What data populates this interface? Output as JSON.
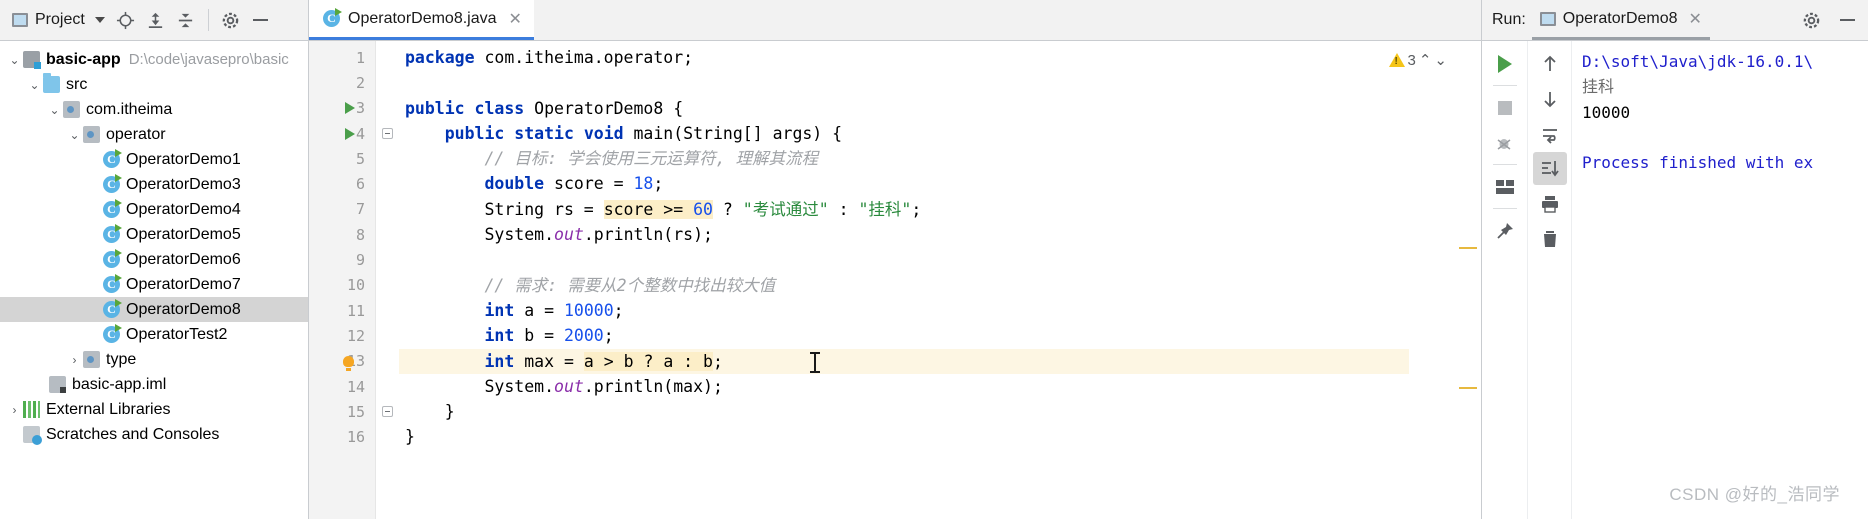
{
  "sidebar": {
    "header": {
      "panel_label": "Project",
      "icons": [
        {
          "name": "project-panel-icon",
          "glyph": "▣"
        },
        {
          "name": "chevron-down-icon",
          "glyph": "▾"
        },
        {
          "name": "locate-target-icon",
          "glyph": "⌖"
        },
        {
          "name": "expand-all-icon",
          "glyph": "⤒"
        },
        {
          "name": "collapse-all-icon",
          "glyph": "⤓"
        },
        {
          "name": "settings-gear-icon",
          "glyph": "⚙"
        },
        {
          "name": "hide-panel-icon",
          "glyph": "—"
        }
      ]
    },
    "tree": [
      {
        "label": "basic-app",
        "path": "D:\\code\\javasepro\\basic",
        "icon": "module-folder-icon",
        "depth": 0,
        "arrow": "expanded",
        "bold": true,
        "selected": false
      },
      {
        "label": "src",
        "path": "",
        "icon": "source-folder-icon",
        "depth": 1,
        "arrow": "expanded",
        "bold": false,
        "selected": false
      },
      {
        "label": "com.itheima",
        "path": "",
        "icon": "package-icon",
        "depth": 2,
        "arrow": "expanded",
        "bold": false,
        "selected": false
      },
      {
        "label": "operator",
        "path": "",
        "icon": "package-icon",
        "depth": 3,
        "arrow": "expanded",
        "bold": false,
        "selected": false
      },
      {
        "label": "OperatorDemo1",
        "path": "",
        "icon": "java-class-icon",
        "depth": 4,
        "arrow": "none",
        "bold": false,
        "selected": false
      },
      {
        "label": "OperatorDemo3",
        "path": "",
        "icon": "java-class-icon",
        "depth": 4,
        "arrow": "none",
        "bold": false,
        "selected": false
      },
      {
        "label": "OperatorDemo4",
        "path": "",
        "icon": "java-class-icon",
        "depth": 4,
        "arrow": "none",
        "bold": false,
        "selected": false
      },
      {
        "label": "OperatorDemo5",
        "path": "",
        "icon": "java-class-icon",
        "depth": 4,
        "arrow": "none",
        "bold": false,
        "selected": false
      },
      {
        "label": "OperatorDemo6",
        "path": "",
        "icon": "java-class-icon",
        "depth": 4,
        "arrow": "none",
        "bold": false,
        "selected": false
      },
      {
        "label": "OperatorDemo7",
        "path": "",
        "icon": "java-class-icon",
        "depth": 4,
        "arrow": "none",
        "bold": false,
        "selected": false
      },
      {
        "label": "OperatorDemo8",
        "path": "",
        "icon": "java-class-icon",
        "depth": 4,
        "arrow": "none",
        "bold": false,
        "selected": true
      },
      {
        "label": "OperatorTest2",
        "path": "",
        "icon": "java-class-icon",
        "depth": 4,
        "arrow": "none",
        "bold": false,
        "selected": false
      },
      {
        "label": "type",
        "path": "",
        "icon": "package-icon",
        "depth": 3,
        "arrow": "collapsed",
        "bold": false,
        "selected": false
      },
      {
        "label": "basic-app.iml",
        "path": "",
        "icon": "iml-file-icon",
        "depth": 2,
        "arrow": "none",
        "bold": false,
        "selected": false
      },
      {
        "label": "External Libraries",
        "path": "",
        "icon": "libraries-icon",
        "depth": 0,
        "arrow": "collapsed",
        "bold": false,
        "selected": false
      },
      {
        "label": "Scratches and Consoles",
        "path": "",
        "icon": "scratches-icon",
        "depth": 0,
        "arrow": "none",
        "bold": false,
        "selected": false
      }
    ]
  },
  "editor": {
    "tab": {
      "label": "OperatorDemo8.java",
      "close_glyph": "✕",
      "icon": "java-class-icon"
    },
    "inspection": {
      "warning_count": "3",
      "up_glyph": "⌃",
      "down_glyph": "⌄"
    },
    "lines": [
      {
        "n": "1",
        "gutter": "",
        "fold": "",
        "highlight": false
      },
      {
        "n": "2",
        "gutter": "",
        "fold": "",
        "highlight": false
      },
      {
        "n": "3",
        "gutter": "run",
        "fold": "",
        "highlight": false
      },
      {
        "n": "4",
        "gutter": "run",
        "fold": "minus",
        "highlight": false
      },
      {
        "n": "5",
        "gutter": "",
        "fold": "",
        "highlight": false
      },
      {
        "n": "6",
        "gutter": "",
        "fold": "",
        "highlight": false
      },
      {
        "n": "7",
        "gutter": "",
        "fold": "",
        "highlight": false
      },
      {
        "n": "8",
        "gutter": "",
        "fold": "",
        "highlight": false
      },
      {
        "n": "9",
        "gutter": "",
        "fold": "",
        "highlight": false
      },
      {
        "n": "10",
        "gutter": "",
        "fold": "",
        "highlight": false
      },
      {
        "n": "11",
        "gutter": "",
        "fold": "",
        "highlight": false
      },
      {
        "n": "12",
        "gutter": "",
        "fold": "",
        "highlight": false
      },
      {
        "n": "13",
        "gutter": "bulb",
        "fold": "",
        "highlight": true
      },
      {
        "n": "14",
        "gutter": "",
        "fold": "",
        "highlight": false
      },
      {
        "n": "15",
        "gutter": "",
        "fold": "minus",
        "highlight": false
      },
      {
        "n": "16",
        "gutter": "",
        "fold": "",
        "highlight": false
      }
    ],
    "code_text": [
      "package com.itheima.operator;",
      "",
      "public class OperatorDemo8 {",
      "    public static void main(String[] args) {",
      "        // 目标: 学会使用三元运算符, 理解其流程",
      "        double score = 18;",
      "        String rs = score >= 60 ? \"考试通过\" : \"挂科\";",
      "        System.out.println(rs);",
      "",
      "        // 需求: 需要从2个整数中找出较大值",
      "        int a = 10000;",
      "        int b = 2000;",
      "        int max = a > b ? a : b;",
      "        System.out.println(max);",
      "    }",
      "}"
    ]
  },
  "run_panel": {
    "label": "Run:",
    "tab_label": "OperatorDemo8",
    "tab_close_glyph": "✕",
    "header_icons": [
      {
        "name": "run-settings-gear-icon",
        "glyph": "⚙"
      },
      {
        "name": "hide-run-panel-icon",
        "glyph": "—"
      }
    ],
    "tools_left": [
      {
        "name": "rerun-button",
        "glyph": "▶"
      },
      {
        "name": "stop-button",
        "glyph": "■"
      },
      {
        "name": "debug-button",
        "glyph": "🐞"
      },
      {
        "name": "layout-button",
        "glyph": "▤"
      },
      {
        "name": "pin-tab-button",
        "glyph": "📌"
      }
    ],
    "tools_right": [
      {
        "name": "up-the-stack-trace-button",
        "glyph": "↑"
      },
      {
        "name": "down-the-stack-trace-button",
        "glyph": "↓"
      },
      {
        "name": "soft-wrap-button",
        "glyph": "⇥"
      },
      {
        "name": "scroll-to-end-button",
        "glyph": "⇟"
      },
      {
        "name": "print-button",
        "glyph": "🖶"
      },
      {
        "name": "clear-all-button",
        "glyph": "🗑"
      }
    ],
    "console": [
      {
        "text": "D:\\soft\\Java\\jdk-16.0.1\\",
        "kind": "link"
      },
      {
        "text": "挂科",
        "kind": "out"
      },
      {
        "text": "10000",
        "kind": "plain"
      },
      {
        "text": "",
        "kind": "plain"
      },
      {
        "text": "Process finished with ex",
        "kind": "link"
      }
    ]
  },
  "watermark": "CSDN @好的_浩同学",
  "colors": {
    "accent": "#3c7ddd",
    "keyword": "#0033b3",
    "string": "#2a8a3d",
    "number": "#1750eb",
    "comment": "#a0a3a7",
    "field": "#8b2faa",
    "highlight": "#fceec8",
    "selection": "#d4d4d4"
  }
}
